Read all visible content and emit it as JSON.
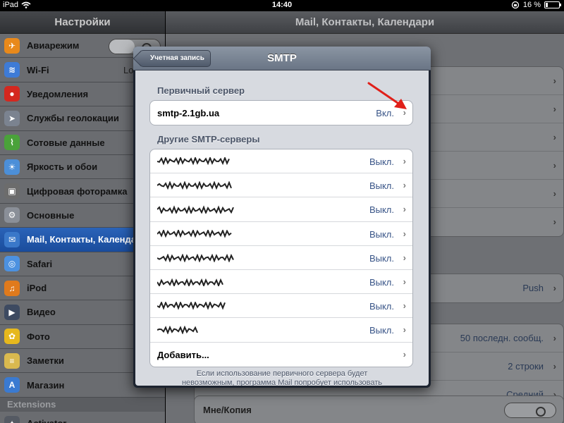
{
  "status_bar": {
    "carrier": "iPad",
    "time": "14:40",
    "battery_text": "16 %",
    "battery_level": 0.16
  },
  "sidebar": {
    "title": "Настройки",
    "items": [
      {
        "label": "Авиарежим",
        "icon": "airplane-icon",
        "color": "#e8891b",
        "control": "switch"
      },
      {
        "label": "Wi-Fi",
        "icon": "wifi-icon",
        "color": "#3e7bd6",
        "value": "Lo"
      },
      {
        "label": "Уведомления",
        "icon": "notifications-icon",
        "color": "#d4281f"
      },
      {
        "label": "Службы геолокации",
        "icon": "location-icon",
        "color": "#7b8390"
      },
      {
        "label": "Сотовые данные",
        "icon": "cellular-icon",
        "color": "#4aa23a"
      },
      {
        "label": "Яркость и обои",
        "icon": "brightness-icon",
        "color": "#4c8fd8"
      },
      {
        "label": "Цифровая фоторамка",
        "icon": "photo-frame-icon",
        "color": "#6c6c6c"
      },
      {
        "label": "Основные",
        "icon": "gear-icon",
        "color": "#8a8f98"
      },
      {
        "label": "Mail, Контакты, Календари",
        "icon": "mail-icon",
        "color": "#3a78c9",
        "selected": true
      },
      {
        "label": "Safari",
        "icon": "safari-icon",
        "color": "#4c91e0"
      },
      {
        "label": "iPod",
        "icon": "ipod-icon",
        "color": "#e07a1c"
      },
      {
        "label": "Видео",
        "icon": "video-icon",
        "color": "#3d4a61"
      },
      {
        "label": "Фото",
        "icon": "photos-icon",
        "color": "#e6b81d"
      },
      {
        "label": "Заметки",
        "icon": "notes-icon",
        "color": "#d9b94f"
      },
      {
        "label": "Магазин",
        "icon": "store-icon",
        "color": "#3a7ad1"
      }
    ],
    "section_label": "Extensions",
    "extension_items": [
      {
        "label": "Activator",
        "icon": "activator-icon",
        "color": "#555a63"
      }
    ]
  },
  "right_pane": {
    "title": "Mail, Контакты, Календари",
    "group1_rows": 6,
    "push_row": {
      "value": "Push"
    },
    "rows2": [
      {
        "value": "50 последн. сообщ."
      },
      {
        "value": "2 строки"
      },
      {
        "value": "Средний"
      }
    ],
    "copy_row": {
      "label": "Мне/Копия"
    }
  },
  "popover": {
    "title": "SMTP",
    "back_label": "Учетная запись",
    "primary_section": "Первичный сервер",
    "primary_server": {
      "name": "smtp-2.1gb.ua",
      "status": "Вкл."
    },
    "other_section": "Другие SMTP-серверы",
    "other_servers": [
      {
        "status": "Выкл."
      },
      {
        "status": "Выкл."
      },
      {
        "status": "Выкл."
      },
      {
        "status": "Выкл."
      },
      {
        "status": "Выкл."
      },
      {
        "status": "Выкл."
      },
      {
        "status": "Выкл."
      },
      {
        "status": "Выкл."
      }
    ],
    "add_label": "Добавить...",
    "footer_line1": "Если использование первичного сервера будет",
    "footer_line2": "невозможным, программа Mail попробует использовать"
  },
  "colors": {
    "accent_blue": "#2a63b8",
    "value_blue": "#385487",
    "annotation_arrow": "#e0201a"
  }
}
